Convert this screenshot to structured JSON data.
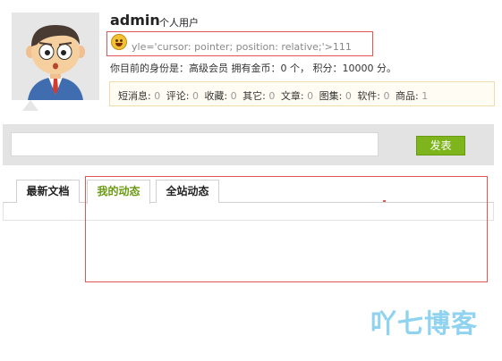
{
  "profile": {
    "username": "admin",
    "user_type": "个人用户",
    "raw_text": "yle='cursor: pointer; position: relative;'>111",
    "status_line": "你目前的身份是：高级会员 拥有金币：0 个， 积分：10000 分。",
    "counts": [
      {
        "label": "短消息:",
        "value": "0"
      },
      {
        "label": "评论:",
        "value": "0"
      },
      {
        "label": "收藏:",
        "value": "0"
      },
      {
        "label": "其它:",
        "value": "0"
      },
      {
        "label": "文章:",
        "value": "0"
      },
      {
        "label": "图集:",
        "value": "0"
      },
      {
        "label": "软件:",
        "value": "0"
      },
      {
        "label": "商品:",
        "value": "1"
      }
    ]
  },
  "post": {
    "input_value": "",
    "button_label": "发表"
  },
  "tabs": [
    {
      "label": "最新文档"
    },
    {
      "label": "我的动态"
    },
    {
      "label": "全站动态"
    }
  ],
  "colors": {
    "accent": "#7fb51c",
    "active_tab_text": "#6a9a12",
    "highlight_border": "#e05555",
    "watermark": "#8fd3f0"
  },
  "watermark": "吖七博客"
}
